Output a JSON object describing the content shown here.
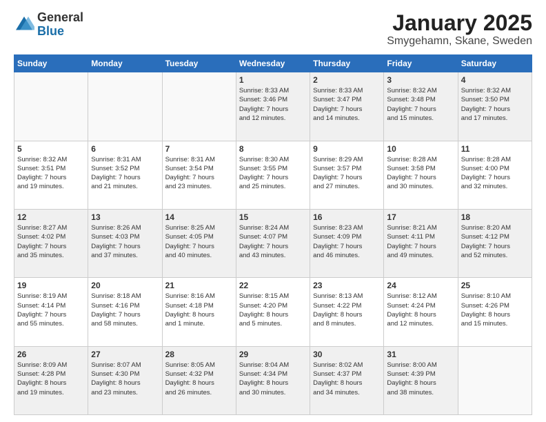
{
  "logo": {
    "general": "General",
    "blue": "Blue"
  },
  "title": "January 2025",
  "subtitle": "Smygehamn, Skane, Sweden",
  "weekdays": [
    "Sunday",
    "Monday",
    "Tuesday",
    "Wednesday",
    "Thursday",
    "Friday",
    "Saturday"
  ],
  "weeks": [
    [
      {
        "day": "",
        "info": ""
      },
      {
        "day": "",
        "info": ""
      },
      {
        "day": "",
        "info": ""
      },
      {
        "day": "1",
        "info": "Sunrise: 8:33 AM\nSunset: 3:46 PM\nDaylight: 7 hours\nand 12 minutes."
      },
      {
        "day": "2",
        "info": "Sunrise: 8:33 AM\nSunset: 3:47 PM\nDaylight: 7 hours\nand 14 minutes."
      },
      {
        "day": "3",
        "info": "Sunrise: 8:32 AM\nSunset: 3:48 PM\nDaylight: 7 hours\nand 15 minutes."
      },
      {
        "day": "4",
        "info": "Sunrise: 8:32 AM\nSunset: 3:50 PM\nDaylight: 7 hours\nand 17 minutes."
      }
    ],
    [
      {
        "day": "5",
        "info": "Sunrise: 8:32 AM\nSunset: 3:51 PM\nDaylight: 7 hours\nand 19 minutes."
      },
      {
        "day": "6",
        "info": "Sunrise: 8:31 AM\nSunset: 3:52 PM\nDaylight: 7 hours\nand 21 minutes."
      },
      {
        "day": "7",
        "info": "Sunrise: 8:31 AM\nSunset: 3:54 PM\nDaylight: 7 hours\nand 23 minutes."
      },
      {
        "day": "8",
        "info": "Sunrise: 8:30 AM\nSunset: 3:55 PM\nDaylight: 7 hours\nand 25 minutes."
      },
      {
        "day": "9",
        "info": "Sunrise: 8:29 AM\nSunset: 3:57 PM\nDaylight: 7 hours\nand 27 minutes."
      },
      {
        "day": "10",
        "info": "Sunrise: 8:28 AM\nSunset: 3:58 PM\nDaylight: 7 hours\nand 30 minutes."
      },
      {
        "day": "11",
        "info": "Sunrise: 8:28 AM\nSunset: 4:00 PM\nDaylight: 7 hours\nand 32 minutes."
      }
    ],
    [
      {
        "day": "12",
        "info": "Sunrise: 8:27 AM\nSunset: 4:02 PM\nDaylight: 7 hours\nand 35 minutes."
      },
      {
        "day": "13",
        "info": "Sunrise: 8:26 AM\nSunset: 4:03 PM\nDaylight: 7 hours\nand 37 minutes."
      },
      {
        "day": "14",
        "info": "Sunrise: 8:25 AM\nSunset: 4:05 PM\nDaylight: 7 hours\nand 40 minutes."
      },
      {
        "day": "15",
        "info": "Sunrise: 8:24 AM\nSunset: 4:07 PM\nDaylight: 7 hours\nand 43 minutes."
      },
      {
        "day": "16",
        "info": "Sunrise: 8:23 AM\nSunset: 4:09 PM\nDaylight: 7 hours\nand 46 minutes."
      },
      {
        "day": "17",
        "info": "Sunrise: 8:21 AM\nSunset: 4:11 PM\nDaylight: 7 hours\nand 49 minutes."
      },
      {
        "day": "18",
        "info": "Sunrise: 8:20 AM\nSunset: 4:12 PM\nDaylight: 7 hours\nand 52 minutes."
      }
    ],
    [
      {
        "day": "19",
        "info": "Sunrise: 8:19 AM\nSunset: 4:14 PM\nDaylight: 7 hours\nand 55 minutes."
      },
      {
        "day": "20",
        "info": "Sunrise: 8:18 AM\nSunset: 4:16 PM\nDaylight: 7 hours\nand 58 minutes."
      },
      {
        "day": "21",
        "info": "Sunrise: 8:16 AM\nSunset: 4:18 PM\nDaylight: 8 hours\nand 1 minute."
      },
      {
        "day": "22",
        "info": "Sunrise: 8:15 AM\nSunset: 4:20 PM\nDaylight: 8 hours\nand 5 minutes."
      },
      {
        "day": "23",
        "info": "Sunrise: 8:13 AM\nSunset: 4:22 PM\nDaylight: 8 hours\nand 8 minutes."
      },
      {
        "day": "24",
        "info": "Sunrise: 8:12 AM\nSunset: 4:24 PM\nDaylight: 8 hours\nand 12 minutes."
      },
      {
        "day": "25",
        "info": "Sunrise: 8:10 AM\nSunset: 4:26 PM\nDaylight: 8 hours\nand 15 minutes."
      }
    ],
    [
      {
        "day": "26",
        "info": "Sunrise: 8:09 AM\nSunset: 4:28 PM\nDaylight: 8 hours\nand 19 minutes."
      },
      {
        "day": "27",
        "info": "Sunrise: 8:07 AM\nSunset: 4:30 PM\nDaylight: 8 hours\nand 23 minutes."
      },
      {
        "day": "28",
        "info": "Sunrise: 8:05 AM\nSunset: 4:32 PM\nDaylight: 8 hours\nand 26 minutes."
      },
      {
        "day": "29",
        "info": "Sunrise: 8:04 AM\nSunset: 4:34 PM\nDaylight: 8 hours\nand 30 minutes."
      },
      {
        "day": "30",
        "info": "Sunrise: 8:02 AM\nSunset: 4:37 PM\nDaylight: 8 hours\nand 34 minutes."
      },
      {
        "day": "31",
        "info": "Sunrise: 8:00 AM\nSunset: 4:39 PM\nDaylight: 8 hours\nand 38 minutes."
      },
      {
        "day": "",
        "info": ""
      }
    ]
  ]
}
